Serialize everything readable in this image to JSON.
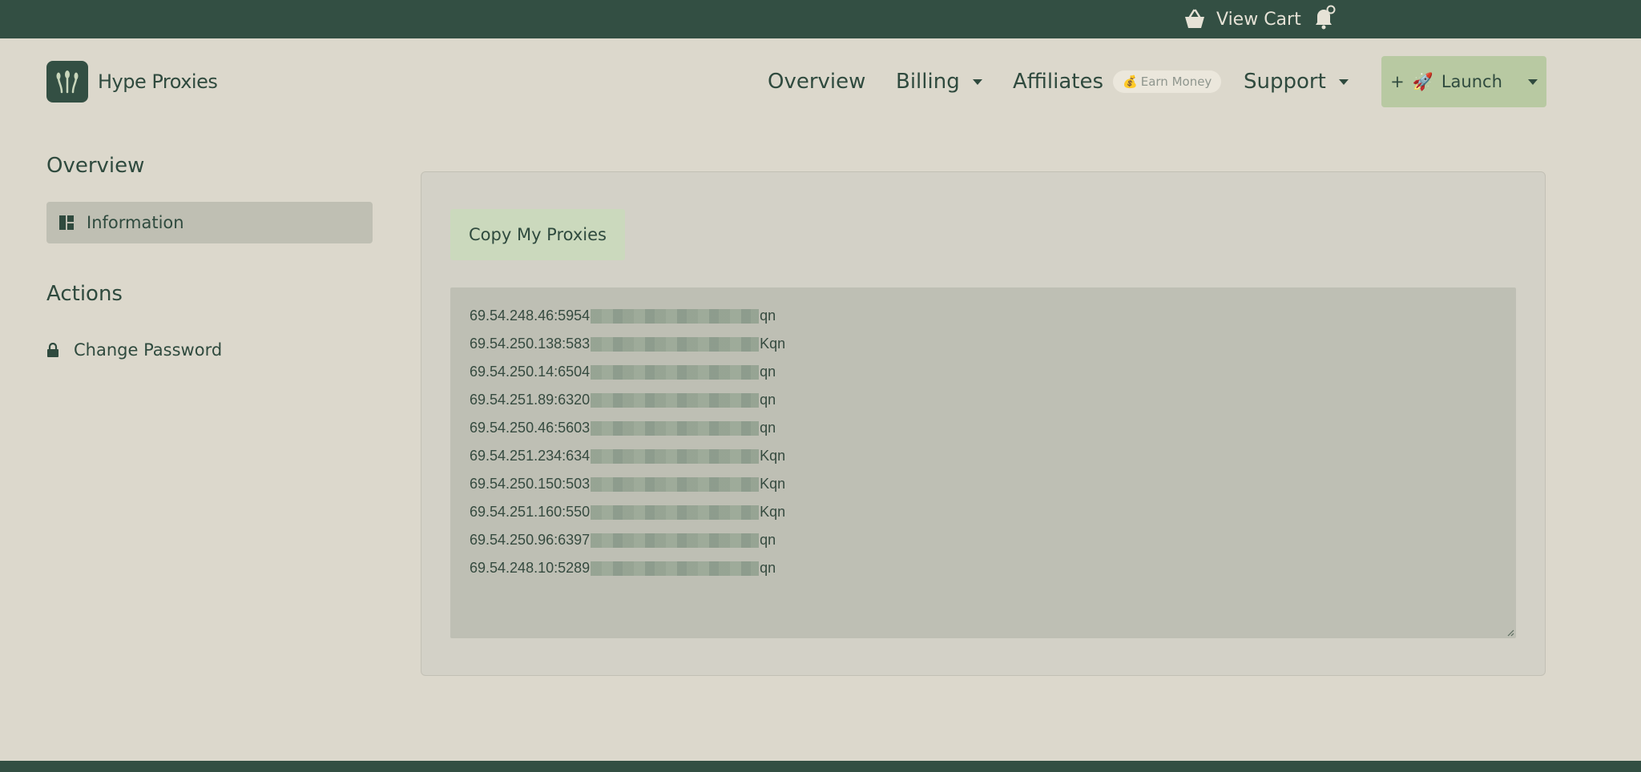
{
  "topbar": {
    "cart_label": "View Cart",
    "cart_icon": "basket-icon",
    "bell_icon": "bell-icon"
  },
  "brand": {
    "name": "Hype Proxies",
    "logo_icon": "plant-logo-icon"
  },
  "nav": {
    "overview": "Overview",
    "billing": "Billing",
    "affiliates": "Affiliates",
    "earn_badge": "Earn Money",
    "support": "Support",
    "launch": "Launch",
    "launch_prefix": "+"
  },
  "sidebar": {
    "overview_heading": "Overview",
    "information": "Information",
    "actions_heading": "Actions",
    "change_password": "Change Password"
  },
  "main": {
    "copy_button": "Copy My Proxies",
    "proxies": [
      {
        "prefix": "69.54.248.46:5954",
        "suffix": "qn"
      },
      {
        "prefix": "69.54.250.138:583",
        "suffix": "Kqn"
      },
      {
        "prefix": "69.54.250.14:6504",
        "suffix": "qn"
      },
      {
        "prefix": "69.54.251.89:6320",
        "suffix": "qn"
      },
      {
        "prefix": "69.54.250.46:5603",
        "suffix": "qn"
      },
      {
        "prefix": "69.54.251.234:634",
        "suffix": "Kqn"
      },
      {
        "prefix": "69.54.250.150:503",
        "suffix": "Kqn"
      },
      {
        "prefix": "69.54.251.160:550",
        "suffix": "Kqn"
      },
      {
        "prefix": "69.54.250.96:6397",
        "suffix": "qn"
      },
      {
        "prefix": "69.54.248.10:5289",
        "suffix": "qn"
      }
    ]
  },
  "colors": {
    "bar": "#334f43",
    "background": "#dcd8cc",
    "accent": "#b8c9a2",
    "text": "#2f4a3e"
  }
}
